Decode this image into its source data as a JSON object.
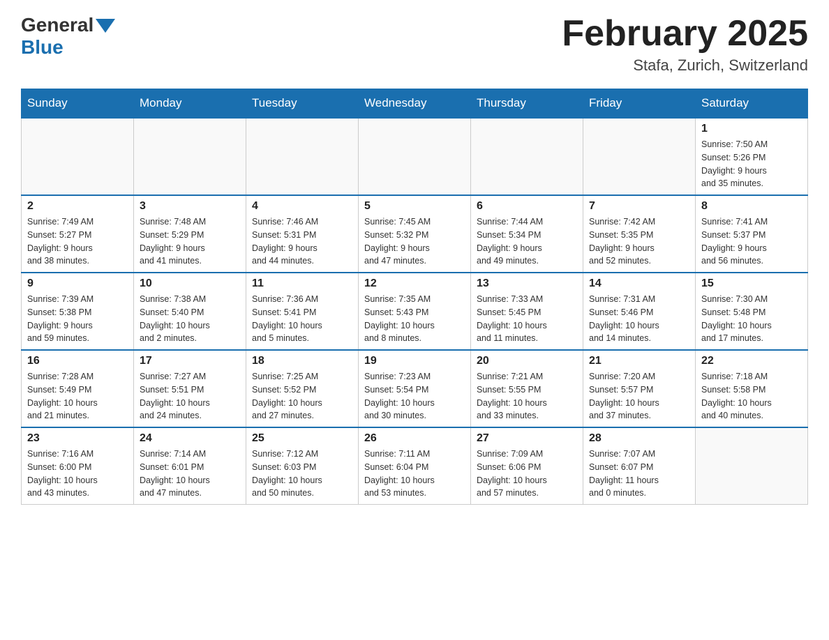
{
  "header": {
    "logo_general": "General",
    "logo_blue": "Blue",
    "month_title": "February 2025",
    "location": "Stafa, Zurich, Switzerland"
  },
  "days_of_week": [
    "Sunday",
    "Monday",
    "Tuesday",
    "Wednesday",
    "Thursday",
    "Friday",
    "Saturday"
  ],
  "weeks": [
    [
      {
        "day": "",
        "info": ""
      },
      {
        "day": "",
        "info": ""
      },
      {
        "day": "",
        "info": ""
      },
      {
        "day": "",
        "info": ""
      },
      {
        "day": "",
        "info": ""
      },
      {
        "day": "",
        "info": ""
      },
      {
        "day": "1",
        "info": "Sunrise: 7:50 AM\nSunset: 5:26 PM\nDaylight: 9 hours\nand 35 minutes."
      }
    ],
    [
      {
        "day": "2",
        "info": "Sunrise: 7:49 AM\nSunset: 5:27 PM\nDaylight: 9 hours\nand 38 minutes."
      },
      {
        "day": "3",
        "info": "Sunrise: 7:48 AM\nSunset: 5:29 PM\nDaylight: 9 hours\nand 41 minutes."
      },
      {
        "day": "4",
        "info": "Sunrise: 7:46 AM\nSunset: 5:31 PM\nDaylight: 9 hours\nand 44 minutes."
      },
      {
        "day": "5",
        "info": "Sunrise: 7:45 AM\nSunset: 5:32 PM\nDaylight: 9 hours\nand 47 minutes."
      },
      {
        "day": "6",
        "info": "Sunrise: 7:44 AM\nSunset: 5:34 PM\nDaylight: 9 hours\nand 49 minutes."
      },
      {
        "day": "7",
        "info": "Sunrise: 7:42 AM\nSunset: 5:35 PM\nDaylight: 9 hours\nand 52 minutes."
      },
      {
        "day": "8",
        "info": "Sunrise: 7:41 AM\nSunset: 5:37 PM\nDaylight: 9 hours\nand 56 minutes."
      }
    ],
    [
      {
        "day": "9",
        "info": "Sunrise: 7:39 AM\nSunset: 5:38 PM\nDaylight: 9 hours\nand 59 minutes."
      },
      {
        "day": "10",
        "info": "Sunrise: 7:38 AM\nSunset: 5:40 PM\nDaylight: 10 hours\nand 2 minutes."
      },
      {
        "day": "11",
        "info": "Sunrise: 7:36 AM\nSunset: 5:41 PM\nDaylight: 10 hours\nand 5 minutes."
      },
      {
        "day": "12",
        "info": "Sunrise: 7:35 AM\nSunset: 5:43 PM\nDaylight: 10 hours\nand 8 minutes."
      },
      {
        "day": "13",
        "info": "Sunrise: 7:33 AM\nSunset: 5:45 PM\nDaylight: 10 hours\nand 11 minutes."
      },
      {
        "day": "14",
        "info": "Sunrise: 7:31 AM\nSunset: 5:46 PM\nDaylight: 10 hours\nand 14 minutes."
      },
      {
        "day": "15",
        "info": "Sunrise: 7:30 AM\nSunset: 5:48 PM\nDaylight: 10 hours\nand 17 minutes."
      }
    ],
    [
      {
        "day": "16",
        "info": "Sunrise: 7:28 AM\nSunset: 5:49 PM\nDaylight: 10 hours\nand 21 minutes."
      },
      {
        "day": "17",
        "info": "Sunrise: 7:27 AM\nSunset: 5:51 PM\nDaylight: 10 hours\nand 24 minutes."
      },
      {
        "day": "18",
        "info": "Sunrise: 7:25 AM\nSunset: 5:52 PM\nDaylight: 10 hours\nand 27 minutes."
      },
      {
        "day": "19",
        "info": "Sunrise: 7:23 AM\nSunset: 5:54 PM\nDaylight: 10 hours\nand 30 minutes."
      },
      {
        "day": "20",
        "info": "Sunrise: 7:21 AM\nSunset: 5:55 PM\nDaylight: 10 hours\nand 33 minutes."
      },
      {
        "day": "21",
        "info": "Sunrise: 7:20 AM\nSunset: 5:57 PM\nDaylight: 10 hours\nand 37 minutes."
      },
      {
        "day": "22",
        "info": "Sunrise: 7:18 AM\nSunset: 5:58 PM\nDaylight: 10 hours\nand 40 minutes."
      }
    ],
    [
      {
        "day": "23",
        "info": "Sunrise: 7:16 AM\nSunset: 6:00 PM\nDaylight: 10 hours\nand 43 minutes."
      },
      {
        "day": "24",
        "info": "Sunrise: 7:14 AM\nSunset: 6:01 PM\nDaylight: 10 hours\nand 47 minutes."
      },
      {
        "day": "25",
        "info": "Sunrise: 7:12 AM\nSunset: 6:03 PM\nDaylight: 10 hours\nand 50 minutes."
      },
      {
        "day": "26",
        "info": "Sunrise: 7:11 AM\nSunset: 6:04 PM\nDaylight: 10 hours\nand 53 minutes."
      },
      {
        "day": "27",
        "info": "Sunrise: 7:09 AM\nSunset: 6:06 PM\nDaylight: 10 hours\nand 57 minutes."
      },
      {
        "day": "28",
        "info": "Sunrise: 7:07 AM\nSunset: 6:07 PM\nDaylight: 11 hours\nand 0 minutes."
      },
      {
        "day": "",
        "info": ""
      }
    ]
  ]
}
